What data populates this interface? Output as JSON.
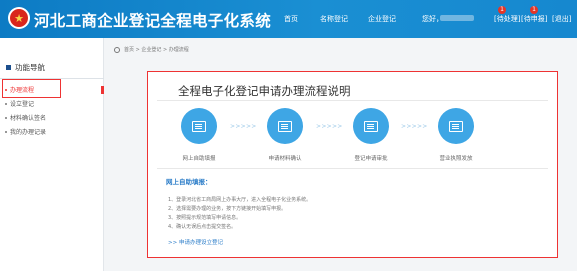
{
  "header": {
    "title": "河北工商企业登记全程电子化系统",
    "nav": [
      "首页",
      "名称登记",
      "企业登记"
    ],
    "greeting": "您好，",
    "msg_badge": "1",
    "msg_label": "[待处理]",
    "todo_badge": "1",
    "todo_label": "[待申报]",
    "logout_label": "[退出]"
  },
  "sidebar": {
    "heading": "功能导航",
    "items": [
      {
        "label": "办理流程",
        "active": true
      },
      {
        "label": "设立登记"
      },
      {
        "label": "材料确认签名"
      },
      {
        "label": "我的办理记录"
      }
    ]
  },
  "breadcrumb": "首页 > 企业登记 > 办理流程",
  "panel": {
    "title": "全程电子化登记申请办理流程说明",
    "steps": [
      "网上自助填报",
      "申请材料确认",
      "登记申请审批",
      "营业执照发放"
    ],
    "arrows": ">>>>>",
    "section_title": "网上自助填报：",
    "instructions": [
      "1、登录河北省工商局网上办事大厅，进入全程电子化业务系统。",
      "2、选择需要办理的业务，按下方链接开始填写申报。",
      "3、按照提示规范填写申请信息。",
      "4、确认无误后点击提交签名。"
    ],
    "link": ">> 申请办理设立登记"
  },
  "colors": {
    "header": "#1a8fd3",
    "accent": "#3ea6e5",
    "highlight": "#e33333"
  }
}
